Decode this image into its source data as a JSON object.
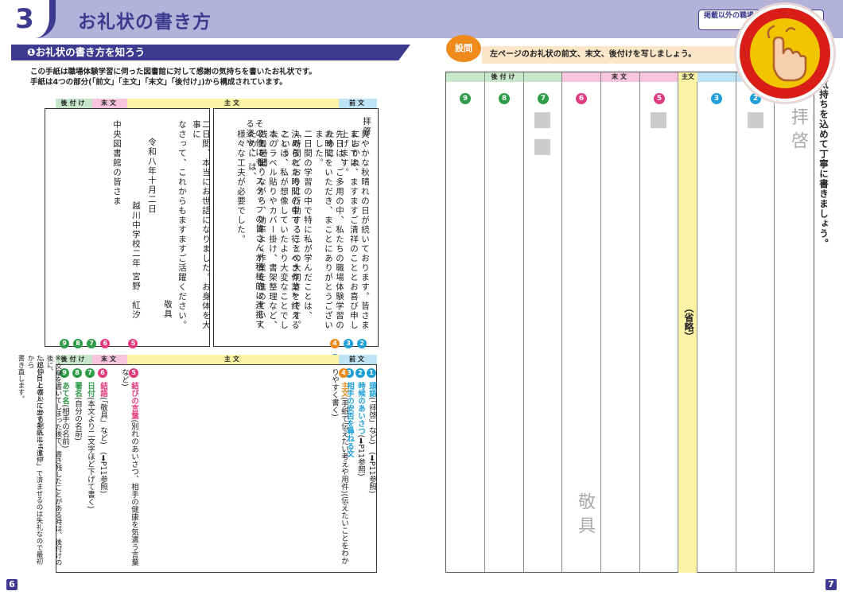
{
  "header": {
    "chapter_number": "3",
    "title": "お礼状の書き方",
    "tag_text": "掲載以外の職場体験先への お礼状"
  },
  "section": {
    "title": "❶お礼状の書き方を知ろう"
  },
  "intro": {
    "line1": "この手紙は職場体験学習に伺った図書館に対して感謝の気持ちを書いたお礼状です。",
    "line2": "手紙は4つの部分(「前文」「主文」「末文」「後付け」)から構成されています。"
  },
  "headers": {
    "atozuke": "後付け",
    "matsubun": "末文",
    "shubun": "主文",
    "zenbun": "前文"
  },
  "letter": {
    "zenbun": [
      "拝啓",
      "爽やかな秋晴れの日が続いております。皆さまにおかれ",
      "ましては、ますますご清祥のこととお喜び申し上げます。"
    ],
    "shubun": [
      "先日は、ご多用の中、私たちの職場体験学習のために",
      "お時間をいただき、まことにありがとうございました。",
      "二日間の学習の中で特に私が学んだことは、",
      "「時間どおりに行動することの大切さ」です。",
      "決められた時間の中で、行うべき作業を終えるという",
      "ことは、私が想像していたより大変なことでした。",
      "本のラベル貼りやカバー掛け、書架整理など、残り時間",
      "に気を配りながら、効率よく作業を進めていくために は、",
      "様々な工夫が必要でした。",
      "その他にも、スタッフの皆さんが積極的に連携する姿や、",
      "どんなに忙しくても笑顔を絶やさない姿がとても印象的",
      "でした。私達が図書館を快適に利用できるのは、スタッフの",
      "皆さんのおかげなのだと、改めて知ることができました。",
      "今回の職場体験学習を通して学んだことを、これからの",
      "学校生活でも生かしていきたいです。"
    ],
    "matsubun": [
      "二日間、本当にお世話になりました。お身体を大事に",
      "なさって、これからもますますご活躍ください。"
    ],
    "keigu": "敬具",
    "date": "令和八年十月二日",
    "sender_school": "越川中学校二年",
    "sender_name": "宮野　紅汐",
    "addressee": "中央図書館の皆さま"
  },
  "legend": [
    {
      "num": "1",
      "title": "頭語",
      "detail": "(「拝啓」など)　(➡P11参照)"
    },
    {
      "num": "2",
      "title": "時候のあいさつ",
      "detail": "(➡P11参照)"
    },
    {
      "num": "3",
      "title": "相手の安否を尋ねる文",
      "detail": ""
    },
    {
      "num": "4",
      "title": "主文",
      "detail": "(手紙で伝えたい考えや用件)(伝えたいことをわかりやすく書く)"
    },
    {
      "num": "5",
      "title": "結びの言葉",
      "detail": "(別れのあいさつ、相手の健康を気遣う言葉など)"
    },
    {
      "num": "6",
      "title": "結語",
      "detail": "(「敬具」など)　(➡P11参照)"
    },
    {
      "num": "7",
      "title": "日付",
      "detail": "(本文より二文字ほど下げて書く)"
    },
    {
      "num": "8",
      "title": "署名",
      "detail": "(自分の名前)"
    },
    {
      "num": "9",
      "title": "あて名",
      "detail": "(相手の名前)"
    }
  ],
  "note": [
    "※文章を書いてしまった後で、書き残したことがある時は、後付けの後に、",
    "「追伸」と書いてから記入します。",
    "ただし目上の人に出す手紙は「追伸」で済ませるのは失礼なので最初から",
    "書き直します。"
  ],
  "right": {
    "question_badge": "設問",
    "question": "左ページのお礼状の前文、末文、後付けを写しましょう。",
    "sample_haikei": "拝啓",
    "sample_keigu": "敬具",
    "omitted": "（省略）",
    "side_note": "気持ちを込めて丁寧に書きましょう。"
  },
  "pages": {
    "left": "6",
    "right": "7"
  },
  "colors": {
    "navy": "#3d3a8f",
    "green": "#2e9b48",
    "pink": "#e23a7e",
    "orange": "#ef8a1c",
    "blue": "#1f9fd8",
    "yellow": "#fbf3a6"
  }
}
